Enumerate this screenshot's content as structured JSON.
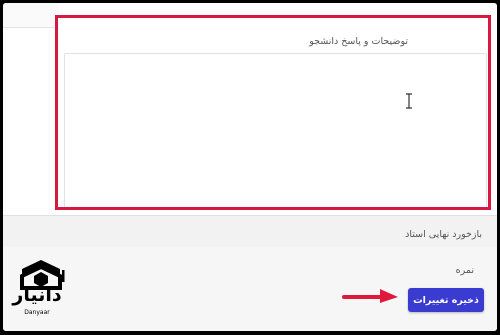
{
  "form": {
    "comments_label": "توضیحات و پاسخ دانشجو",
    "comments_value": "",
    "feedback_label": "بازخورد نهایی استاد",
    "grade_label": "نمره",
    "save_button_label": "ذخیره تغییرات"
  },
  "watermark": {
    "brand_fa": "دانیار",
    "brand_en": "Danyaar"
  },
  "annotation": {
    "highlight_color": "#d6193e",
    "arrow_color": "#e0183b",
    "arrow_icon": "arrow-right-icon"
  },
  "colors": {
    "accent": "#3a3bd0"
  }
}
